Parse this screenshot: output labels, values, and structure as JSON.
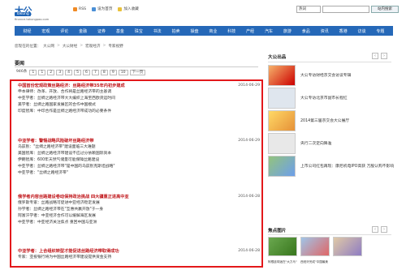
{
  "brand": {
    "cn": "大公",
    "en": "Takung",
    "domain": "finance.takungpao.com"
  },
  "toplinks": {
    "rss": "RSS",
    "home": "设为首页",
    "fav": "加入收藏"
  },
  "search": {
    "select": "热词",
    "button": "站内搜索"
  },
  "nav": [
    "财经",
    "宏观",
    "评论",
    "金融",
    "证券",
    "基金",
    "珠宝",
    "书法",
    "拍卖",
    "操盘",
    "商业",
    "科技",
    "产经",
    "汽车",
    "旅游",
    "食品",
    "资讯",
    "香港",
    "访谈",
    "专题"
  ],
  "breadcrumb": [
    "您现在的位置：",
    "大公网",
    "大公财经",
    "宏观经济",
    "专家视野"
  ],
  "section": {
    "title": "要闻"
  },
  "pager": {
    "count": "946条",
    "first": "1",
    "pages": [
      "1",
      "2",
      "3",
      "4",
      "5",
      "6",
      "7",
      "8",
      "9",
      "10"
    ],
    "next": "下一页"
  },
  "news": [
    {
      "headline": "中国首份宏观政策丝路经济：丝路经济带35年内初步建成",
      "date": "2014-06-29",
      "items": [
        "申本律师：改革、开放、合作将是丝路经济带的主基调",
        "中亚学者：丝绸之路经济带大大编织上海至西欧货运时间",
        "美学者：丝绸之路国家发展区的合作中国模式",
        "印度智库：中印合作是丝绸之路经济带成功的必要条件"
      ]
    },
    {
      "headline": "中亚学者：警惕战略风险破坏丝路经济带",
      "date": "2014-06-29",
      "items": [
        "乌兹别：\"丝绸之路经济带\"建设面临三大难题",
        "美国智库：丝绸之路经济带建设不应过分依赖国际资本",
        "伊朗智库：600年天然气储量可能保障丝路建设",
        "中亚学者：丝绸之路经济带\"是中国的乌兹别克斯坦战略\"",
        "中亚学者：\"丝绸之路经济带\""
      ]
    },
    {
      "headline": "俄学者内容丝路建设卷动保持政治挑战 四大疆重正进高中亚",
      "date": "2014-06-28",
      "items": [
        "俄罗斯专家：丝路战略可促进中亚经济稳定发展",
        "孙学者：丝绸之路经济带在\"互惠共赢开放\"于一身",
        "阿富汗学者：中亚经济合作可以缓解海区发展",
        "中亚学者：中亚经济关注焦点 重回中国与亚洲"
      ]
    },
    {
      "headline": "中亚学者：上合组织转型才能促进丝路经济带取得成功",
      "date": "2014-06-28",
      "items": [
        "专家：亚投银行将为中国丝路经济带建设提供资金支持"
      ]
    }
  ],
  "right": {
    "title": "大公出品",
    "items": [
      "大公专访财经京交会访谈专辑",
      "大公专访北京市副市长程红",
      "2014第三届京交会大公展厅",
      "央行二次定向降准",
      "上市公司红包再现：康尼机电IPO高获 万股认购不影响"
    ],
    "photos_title": "焦点图片",
    "captions": [
      "阿根廷球迷在\"大力马\"",
      "西班牙完成\"中国最美"
    ]
  },
  "colors": {
    "nav": "#2568b8",
    "accent": "#e3181b",
    "headline": "#c0161a"
  }
}
